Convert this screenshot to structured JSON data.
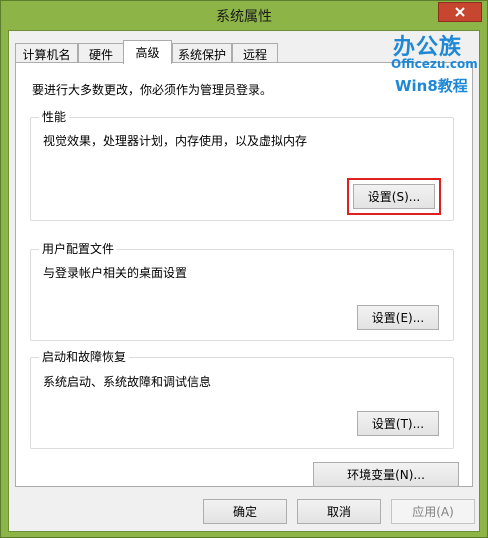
{
  "window": {
    "title": "系统属性"
  },
  "tabs": [
    {
      "label": "计算机名"
    },
    {
      "label": "硬件"
    },
    {
      "label": "高级",
      "active": true
    },
    {
      "label": "系统保护"
    },
    {
      "label": "远程"
    }
  ],
  "admin_note": "要进行大多数更改，你必须作为管理员登录。",
  "performance": {
    "title": "性能",
    "desc": "视觉效果，处理器计划，内存使用，以及虚拟内存",
    "button": "设置(S)..."
  },
  "user_profiles": {
    "title": "用户配置文件",
    "desc": "与登录帐户相关的桌面设置",
    "button": "设置(E)..."
  },
  "startup_recovery": {
    "title": "启动和故障恢复",
    "desc": "系统启动、系统故障和调试信息",
    "button": "设置(T)..."
  },
  "env_button": "环境变量(N)...",
  "footer": {
    "ok": "确定",
    "cancel": "取消",
    "apply": "应用(A)"
  },
  "watermark": {
    "top": "办公族",
    "domain": "Officezu.com",
    "bottom": "Win8教程"
  },
  "colors": {
    "highlight": "#e02020",
    "close": "#c7462f",
    "watermark": "#1e88d6"
  }
}
